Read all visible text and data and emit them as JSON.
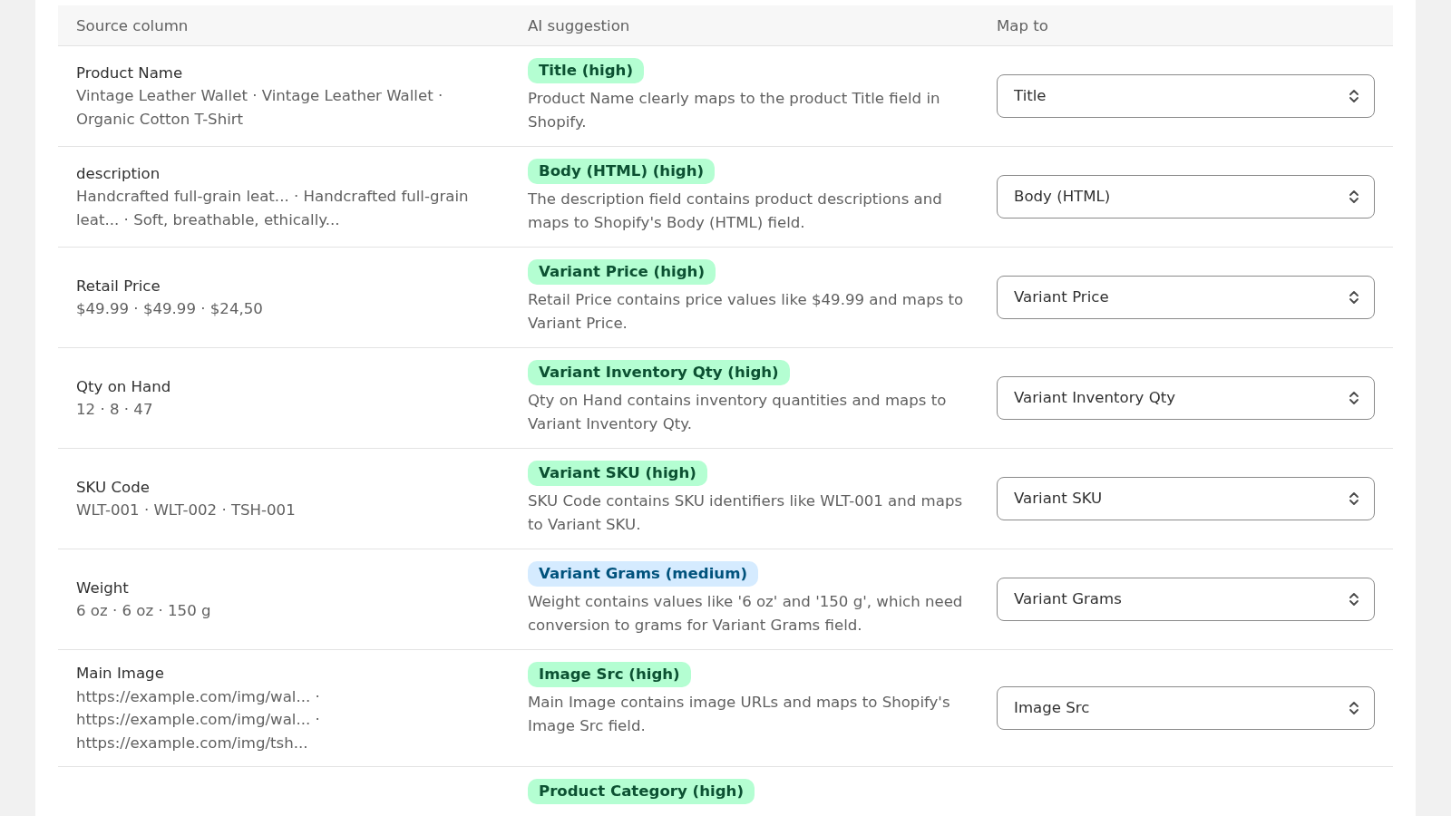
{
  "table": {
    "columns": [
      "Source column",
      "AI suggestion",
      "Map to"
    ],
    "rows": [
      {
        "source": "Product Name",
        "samples": "Vintage Leather Wallet · Vintage Leather Wallet · Organic Cotton T-Shirt",
        "suggestion": "Title (high)",
        "color": "#b4fed2",
        "reason": "Product Name clearly maps to the product Title field in Shopify.",
        "map_to": "Title"
      },
      {
        "source": "description",
        "samples": "Handcrafted full-grain leat... · Handcrafted full-grain leat... · Soft, breathable, ethically...",
        "suggestion": "Body (HTML) (high)",
        "color": "#b4fed2",
        "reason": "The description field contains product descriptions and maps to Shopify's Body (HTML) field.",
        "map_to": "Body (HTML)"
      },
      {
        "source": "Retail Price",
        "samples": "$49.99 · $49.99 · $24,50",
        "suggestion": "Variant Price (high)",
        "color": "#b4fed2",
        "reason": "Retail Price contains price values like $49.99 and maps to Variant Price.",
        "map_to": "Variant Price"
      },
      {
        "source": "Qty on Hand",
        "samples": "12 · 8 · 47",
        "suggestion": "Variant Inventory Qty (high)",
        "color": "#b4fed2",
        "reason": "Qty on Hand contains inventory quantities and maps to Variant Inventory Qty.",
        "map_to": "Variant Inventory Qty"
      },
      {
        "source": "SKU Code",
        "samples": "WLT-001 · WLT-002 · TSH-001",
        "suggestion": "Variant SKU (high)",
        "color": "#b4fed2",
        "reason": "SKU Code contains SKU identifiers like WLT-001 and maps to Variant SKU.",
        "map_to": "Variant SKU"
      },
      {
        "source": "Weight",
        "samples": "6 oz · 6 oz · 150 g",
        "suggestion": "Variant Grams (medium)",
        "color": "#d5ebff",
        "reason": "Weight contains values like '6 oz' and '150 g', which need conversion to grams for Variant Grams field.",
        "map_to": "Variant Grams"
      },
      {
        "source": "Main Image",
        "samples": "https://example.com/img/wal... · https://example.com/img/wal... · https://example.com/img/tsh...",
        "suggestion": "Image Src (high)",
        "color": "#b4fed2",
        "reason": "Main Image contains image URLs and maps to Shopify's Image Src field.",
        "map_to": "Image Src"
      },
      {
        "suggestion": "Product Category (high)",
        "color": "#b4fed2"
      }
    ]
  }
}
